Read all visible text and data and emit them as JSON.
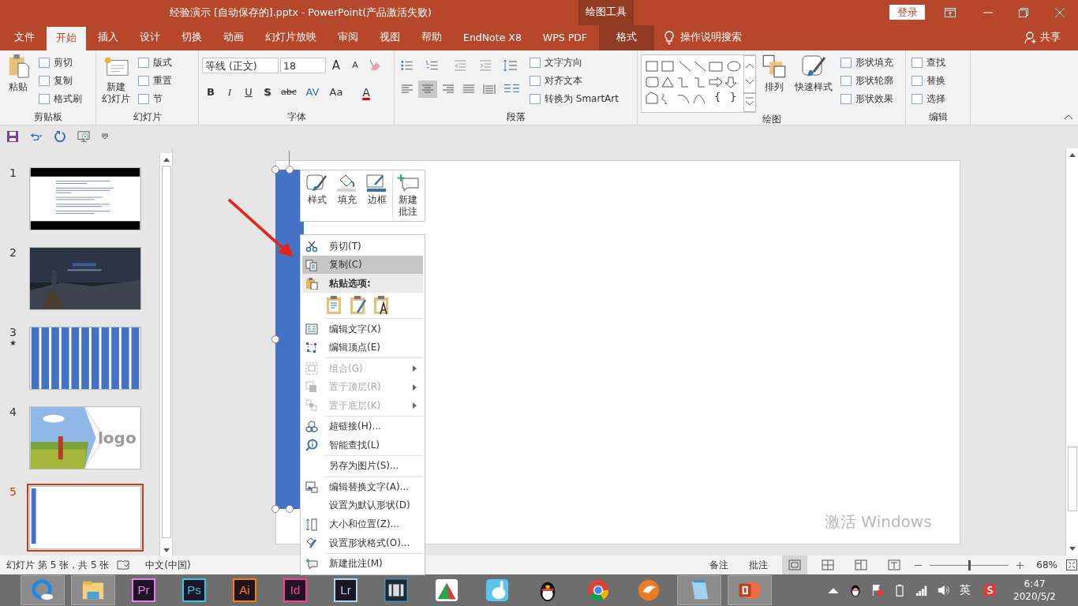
{
  "window": {
    "title": "经验演示 [自动保存的].pptx  -  PowerPoint(产品激活失败)",
    "context_label": "绘图工具",
    "login": "登录"
  },
  "tabs": [
    {
      "label": "文件",
      "selected": false,
      "kind": "normal"
    },
    {
      "label": "开始",
      "selected": true,
      "kind": "normal"
    },
    {
      "label": "插入",
      "selected": false,
      "kind": "normal"
    },
    {
      "label": "设计",
      "selected": false,
      "kind": "normal"
    },
    {
      "label": "切换",
      "selected": false,
      "kind": "normal"
    },
    {
      "label": "动画",
      "selected": false,
      "kind": "normal"
    },
    {
      "label": "幻灯片放映",
      "selected": false,
      "kind": "normal"
    },
    {
      "label": "审阅",
      "selected": false,
      "kind": "normal"
    },
    {
      "label": "视图",
      "selected": false,
      "kind": "normal"
    },
    {
      "label": "帮助",
      "selected": false,
      "kind": "normal"
    },
    {
      "label": "EndNote X8",
      "selected": false,
      "kind": "normal"
    },
    {
      "label": "WPS PDF",
      "selected": false,
      "kind": "normal"
    },
    {
      "label": "格式",
      "selected": false,
      "kind": "context"
    }
  ],
  "tell_me": "操作说明搜索",
  "share": "共享",
  "clipboard": {
    "label": "剪贴板",
    "paste": "粘贴",
    "items": [
      "剪切",
      "复制",
      "格式刷"
    ]
  },
  "slides_group": {
    "label": "幻灯片",
    "new_slide": [
      "新建",
      "幻灯片"
    ],
    "items": [
      "版式",
      "重置",
      "节"
    ]
  },
  "font": {
    "label": "字体",
    "name": "等线 (正文)",
    "size": "18",
    "grow": "A",
    "shrink": "A",
    "styles": [
      "B",
      "I",
      "U",
      "S",
      "abc",
      "AV",
      "Aa"
    ],
    "color_button": "A"
  },
  "paragraph": {
    "label": "段落",
    "alignments": [
      {
        "selected": false
      },
      {
        "selected": true
      },
      {
        "selected": false
      },
      {
        "selected": false
      },
      {
        "selected": false
      }
    ],
    "items": [
      "文字方向",
      "对齐文本",
      "转换为 SmartArt"
    ]
  },
  "drawing": {
    "label": "绘图",
    "gallery_braces": [
      "{",
      "}"
    ],
    "arrange": "排列",
    "quick_styles": "快速样式",
    "items": [
      "形状填充",
      "形状轮廓",
      "形状效果"
    ]
  },
  "editing": {
    "label": "编辑",
    "items": [
      "查找",
      "替换",
      "选择"
    ]
  },
  "slides": [
    {
      "number": "1",
      "kind": "text",
      "selected": false
    },
    {
      "number": "2",
      "selected": false
    },
    {
      "number": "3",
      "kind": "bars",
      "selected": false,
      "mark": "★"
    },
    {
      "number": "4",
      "kind": "photo_logo",
      "selected": false,
      "logo": "logo"
    },
    {
      "number": "5",
      "kind": "blank",
      "selected": true
    }
  ],
  "mini_toolbar": [
    {
      "label": "样式"
    },
    {
      "label": "填充"
    },
    {
      "label": "边框"
    },
    {
      "label": "新建批注"
    }
  ],
  "context_menu": [
    {
      "kind": "item",
      "label": "剪切(T)",
      "disabled": false,
      "submenu": false,
      "selected": false
    },
    {
      "kind": "item",
      "label": "复制(C)",
      "disabled": false,
      "submenu": false,
      "selected": true
    },
    {
      "kind": "header",
      "label": "粘贴选项:"
    },
    {
      "kind": "paste_icons"
    },
    {
      "kind": "separator"
    },
    {
      "kind": "item",
      "label": "编辑文字(X)",
      "disabled": false,
      "submenu": false,
      "selected": false
    },
    {
      "kind": "item",
      "label": "编辑顶点(E)",
      "disabled": false,
      "submenu": false,
      "selected": false
    },
    {
      "kind": "separator"
    },
    {
      "kind": "item",
      "label": "组合(G)",
      "disabled": true,
      "submenu": true,
      "selected": false
    },
    {
      "kind": "item",
      "label": "置于顶层(R)",
      "disabled": true,
      "submenu": true,
      "selected": false
    },
    {
      "kind": "item",
      "label": "置于底层(K)",
      "disabled": true,
      "submenu": true,
      "selected": false
    },
    {
      "kind": "separator"
    },
    {
      "kind": "item",
      "label": "超链接(H)...",
      "disabled": false,
      "submenu": false,
      "selected": false
    },
    {
      "kind": "item",
      "label": "智能查找(L)",
      "disabled": false,
      "submenu": false,
      "selected": false
    },
    {
      "kind": "separator"
    },
    {
      "kind": "item",
      "label": "另存为图片(S)...",
      "disabled": false,
      "submenu": false,
      "selected": false
    },
    {
      "kind": "separator"
    },
    {
      "kind": "item",
      "label": "编辑替换文字(A)...",
      "disabled": false,
      "submenu": false,
      "selected": false
    },
    {
      "kind": "item",
      "label": "设置为默认形状(D)",
      "disabled": false,
      "submenu": false,
      "selected": false
    },
    {
      "kind": "item",
      "label": "大小和位置(Z)...",
      "disabled": false,
      "submenu": false,
      "selected": false
    },
    {
      "kind": "item",
      "label": "设置形状格式(O)...",
      "disabled": false,
      "submenu": false,
      "selected": false
    },
    {
      "kind": "separator"
    },
    {
      "kind": "item",
      "label": "新建批注(M)",
      "disabled": false,
      "submenu": false,
      "selected": false
    }
  ],
  "activation": "激活 Windows",
  "status_bar": {
    "slide_info": "幻灯片 第 5 张，共 5 张",
    "language": "中文(中国)",
    "notes": "备注",
    "comments": "批注",
    "views": [
      {
        "selected": true
      },
      {
        "selected": false
      },
      {
        "selected": false
      },
      {
        "selected": false
      }
    ],
    "zoom_slider": {
      "level": 0.5
    },
    "zoom": "68%"
  },
  "taskbar": {
    "apps": [
      {
        "kind": "browser",
        "running": true
      },
      {
        "kind": "folder",
        "running": true
      },
      {
        "kind": "adobe",
        "label": "Pr",
        "color": "#e77cf0",
        "running": false
      },
      {
        "kind": "adobe",
        "label": "Ps",
        "color": "#31c5f0",
        "running": false
      },
      {
        "kind": "adobe",
        "label": "Ai",
        "color": "#ff7c00",
        "running": false
      },
      {
        "kind": "adobe",
        "label": "Id",
        "color": "#ff3b8d",
        "running": false
      },
      {
        "kind": "adobe",
        "label": "Lr",
        "color": "#add5ec",
        "running": false
      },
      {
        "kind": "film",
        "running": false
      },
      {
        "kind": "chart",
        "running": false
      },
      {
        "kind": "rabbit",
        "running": false
      },
      {
        "kind": "penguin",
        "running": false
      },
      {
        "kind": "chrome",
        "running": false
      },
      {
        "kind": "fox",
        "running": false
      },
      {
        "kind": "notepad",
        "running": true
      },
      {
        "kind": "powerpoint",
        "running": true
      }
    ],
    "ime": "英",
    "time": "6:47",
    "date": "2020/5/2"
  }
}
